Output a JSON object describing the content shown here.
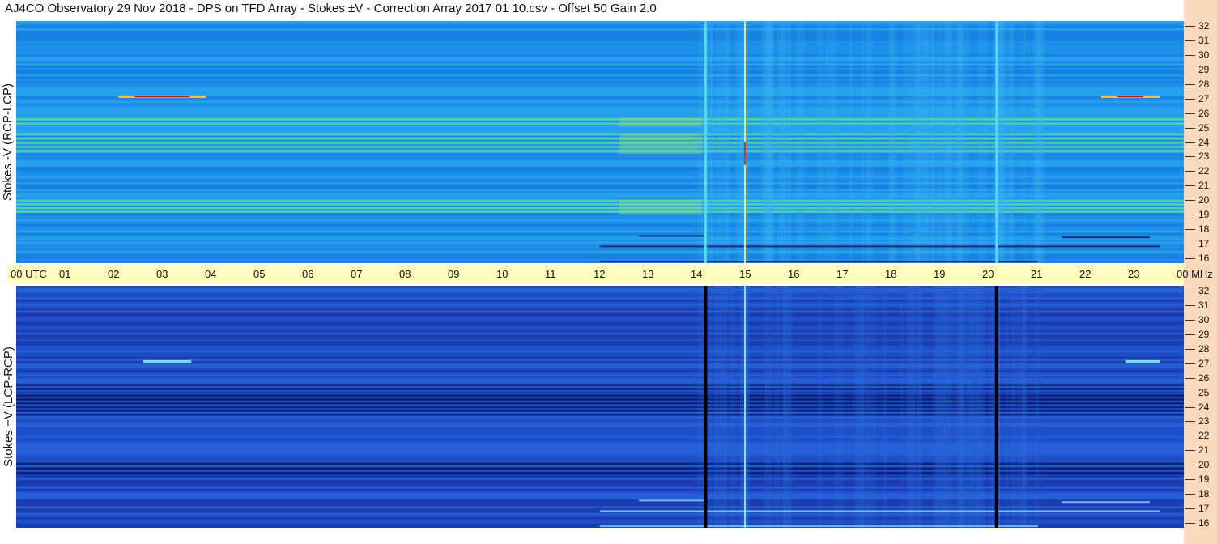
{
  "title": "AJ4CO Observatory  29 Nov 2018  -  DPS on TFD Array  -  Stokes ±V  -  Correction Array 2017 01 10.csv  -  Offset 50  Gain 2.0",
  "colors": {
    "strip": "#fbd9bd",
    "time_bar": "#ffffc0"
  },
  "time_axis": {
    "labels": [
      "00 UTC",
      "01",
      "02",
      "03",
      "04",
      "05",
      "06",
      "07",
      "08",
      "09",
      "10",
      "11",
      "12",
      "13",
      "14",
      "15",
      "16",
      "17",
      "18",
      "19",
      "20",
      "21",
      "22",
      "23",
      "00 MHz"
    ]
  },
  "chart_data": [
    {
      "type": "heatmap",
      "panel": "top",
      "ylabel": "Stokes -V (RCP-LCP)",
      "x_unit": "UTC hour",
      "xlim": [
        0,
        24
      ],
      "y_unit": "MHz",
      "ylim": [
        16,
        32
      ],
      "yticks": [
        "32",
        "31",
        "30",
        "29",
        "28",
        "27",
        "26",
        "25",
        "24",
        "23",
        "22",
        "21",
        "20",
        "19",
        "18",
        "17",
        "16"
      ],
      "bright_bands_mhz": [
        [
          19.2,
          20.2
        ],
        [
          23.2,
          24.6
        ],
        [
          25.0,
          25.6
        ]
      ],
      "vertical_lines_utc": [
        14.17,
        14.98,
        20.15
      ],
      "bursts": [
        {
          "utc": [
            2.1,
            3.9
          ],
          "mhz": 27
        },
        {
          "utc": [
            22.3,
            23.5
          ],
          "mhz": 27
        }
      ]
    },
    {
      "type": "heatmap",
      "panel": "bottom",
      "ylabel": "Stokes +V (LCP-RCP)",
      "x_unit": "UTC hour",
      "xlim": [
        0,
        24
      ],
      "y_unit": "MHz",
      "ylim": [
        16,
        32
      ],
      "yticks": [
        "32",
        "31",
        "30",
        "29",
        "28",
        "27",
        "26",
        "25",
        "24",
        "23",
        "22",
        "21",
        "20",
        "19",
        "18",
        "17",
        "16"
      ],
      "dark_bands_mhz": [
        [
          19.4,
          20.3
        ],
        [
          23.3,
          24.8
        ],
        [
          25.0,
          25.5
        ]
      ],
      "vertical_lines_utc": [
        14.17,
        14.98,
        20.15
      ],
      "bursts": [
        {
          "utc": [
            2.6,
            3.6
          ],
          "mhz": 27
        },
        {
          "utc": [
            22.8,
            23.5
          ],
          "mhz": 27
        }
      ]
    }
  ]
}
